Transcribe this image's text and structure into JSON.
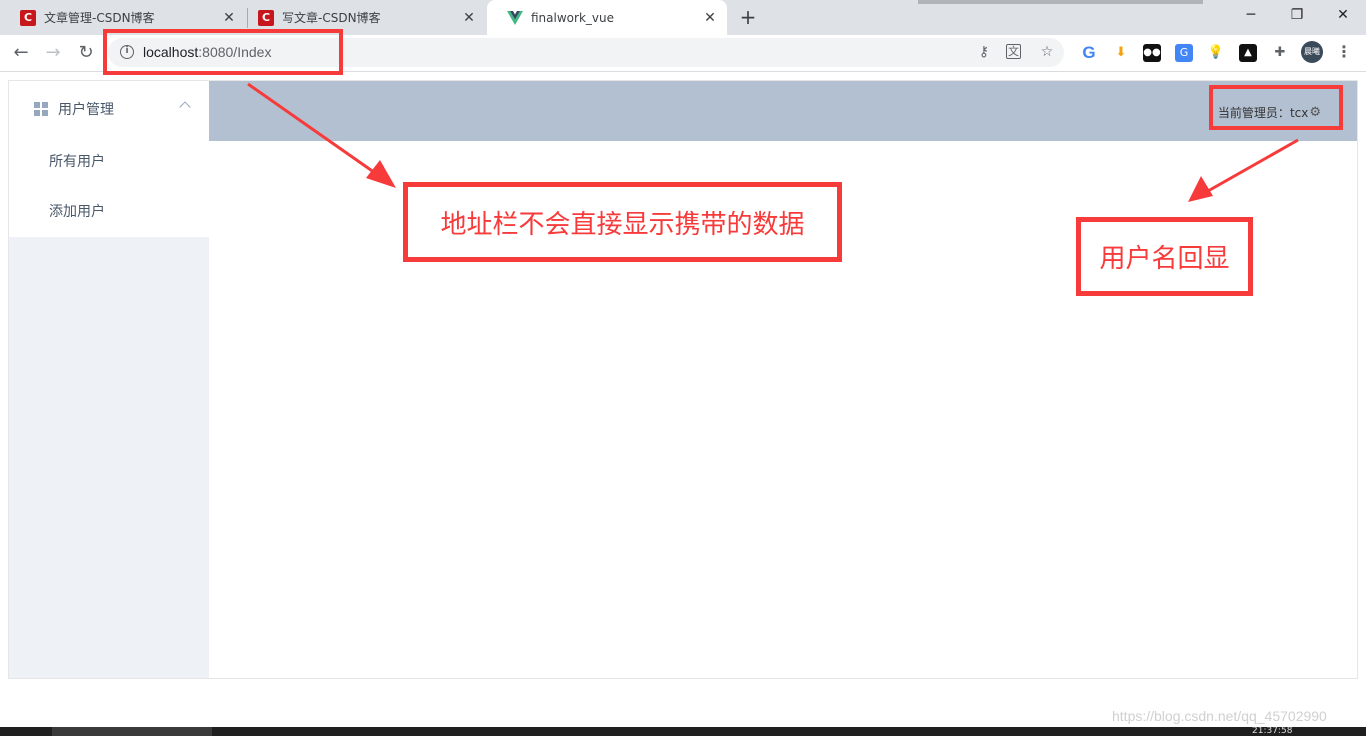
{
  "browser": {
    "tabs": [
      {
        "title": "文章管理-CSDN博客",
        "favicon": "csdn-icon"
      },
      {
        "title": "写文章-CSDN博客",
        "favicon": "csdn-icon"
      },
      {
        "title": "finalwork_vue",
        "favicon": "vue-icon",
        "active": true
      }
    ],
    "new_tab_symbol": "+",
    "url_host": "localhost",
    "url_path": ":8080/Index",
    "avatar_text": "晨曦"
  },
  "app": {
    "sidebar": {
      "group_title": "用户管理",
      "items": [
        "所有用户",
        "添加用户"
      ]
    },
    "header": {
      "admin_label": "当前管理员：",
      "admin_name": "tcx"
    }
  },
  "annotations": {
    "address_note": "地址栏不会直接显示携带的数据",
    "username_note": "用户名回显"
  },
  "watermark": "https://blog.csdn.net/qq_45702990",
  "clock": "21:37:58",
  "colors": {
    "annotation_red": "#f73a3a",
    "header_bg": "#b3c0d1",
    "sidebar_bg": "#eef1f6",
    "csdn_red": "#c8161d",
    "vue_green": "#41b883"
  }
}
